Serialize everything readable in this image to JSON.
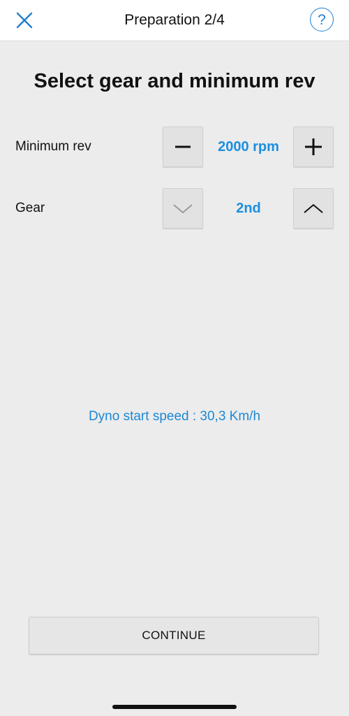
{
  "header": {
    "title": "Preparation 2/4",
    "close_icon": "close-icon",
    "help_icon": "help-icon",
    "help_glyph": "?",
    "accent_color": "#1e7fd0"
  },
  "main": {
    "title": "Select gear and minimum rev"
  },
  "min_rev": {
    "label": "Minimum rev",
    "value": "2000 rpm",
    "decrement_icon": "minus-icon",
    "increment_icon": "plus-icon"
  },
  "gear": {
    "label": "Gear",
    "value": "2nd",
    "decrement_icon": "chevron-down-icon",
    "increment_icon": "chevron-up-icon"
  },
  "info": {
    "text": "Dyno start speed : 30,3 Km/h",
    "color": "#1e88d4"
  },
  "footer": {
    "continue_label": "CONTINUE"
  }
}
